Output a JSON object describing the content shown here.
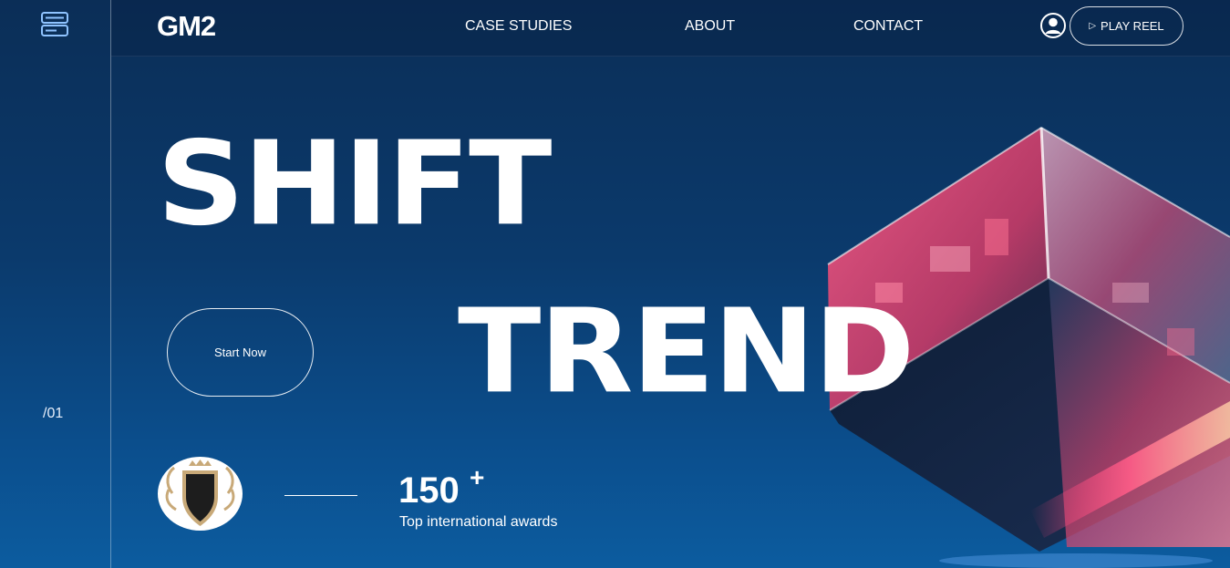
{
  "header": {
    "logo": "GM2",
    "nav": [
      {
        "label": "CASE STUDIES"
      },
      {
        "label": "ABOUT"
      },
      {
        "label": "CONTACT"
      }
    ],
    "play_reel_label": "PLAY REEL"
  },
  "rail": {
    "slide_index": "/01"
  },
  "hero": {
    "headline_line1": "SHIFT",
    "headline_line2": "TREND",
    "cta_label": "Start Now"
  },
  "awards": {
    "count": "150",
    "plus": "+",
    "label": "Top international awards"
  },
  "icons": {
    "menu": "server-menu-icon",
    "user": "user-icon",
    "play": "play-icon"
  },
  "colors": {
    "background_top": "#0b2e57",
    "background_bottom": "#0c5c9f",
    "accent_pink": "#ff3f7a"
  }
}
